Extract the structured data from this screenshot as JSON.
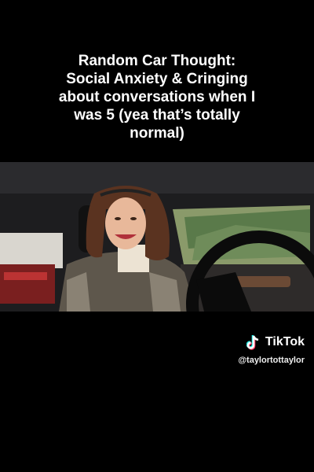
{
  "caption": {
    "lines": [
      "Random Car Thought:",
      "Social Anxiety & Cringing",
      "about conversations when I",
      "was 5 (yea that’s totally",
      "normal)"
    ]
  },
  "watermark": {
    "brand": "TikTok",
    "handle": "@taylortottaylor",
    "icon": "tiktok-logo-icon"
  },
  "colors": {
    "background": "#000000",
    "text": "#ffffff",
    "logo_cyan": "#25f4ee",
    "logo_red": "#fe2c55"
  }
}
